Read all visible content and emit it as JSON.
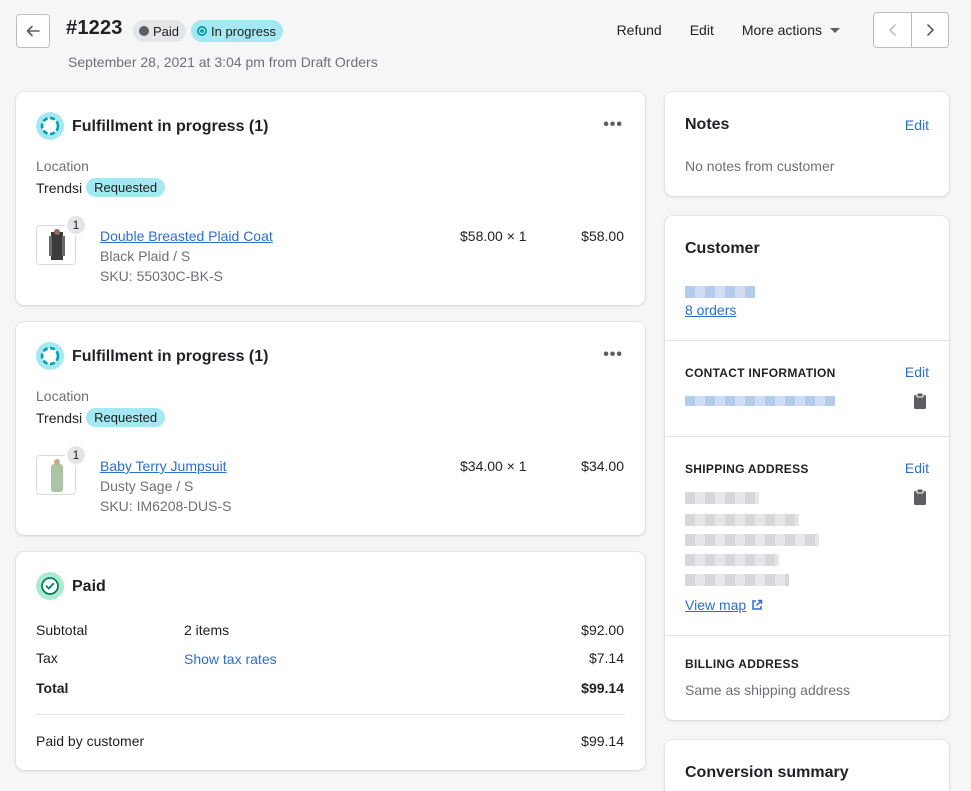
{
  "header": {
    "order_number": "#1223",
    "badges": {
      "paid": "Paid",
      "progress": "In progress"
    },
    "subtitle": "September 28, 2021 at 3:04 pm from Draft Orders",
    "actions": {
      "refund": "Refund",
      "edit": "Edit",
      "more": "More actions"
    }
  },
  "fulfillments": [
    {
      "title": "Fulfillment in progress (1)",
      "location_label": "Location",
      "location": "Trendsi",
      "status": "Requested",
      "item": {
        "qty_badge": "1",
        "name": "Double Breasted Plaid Coat",
        "variant": "Black Plaid / S",
        "sku": "SKU: 55030C-BK-S",
        "unit": "$58.00 × 1",
        "total": "$58.00"
      }
    },
    {
      "title": "Fulfillment in progress (1)",
      "location_label": "Location",
      "location": "Trendsi",
      "status": "Requested",
      "item": {
        "qty_badge": "1",
        "name": "Baby Terry Jumpsuit",
        "variant": "Dusty Sage / S",
        "sku": "SKU: IM6208-DUS-S",
        "unit": "$34.00 × 1",
        "total": "$34.00"
      }
    }
  ],
  "payment": {
    "title": "Paid",
    "subtotal_label": "Subtotal",
    "subtotal_items": "2 items",
    "subtotal_value": "$92.00",
    "tax_label": "Tax",
    "tax_link": "Show tax rates",
    "tax_value": "$7.14",
    "total_label": "Total",
    "total_value": "$99.14",
    "paid_label": "Paid by customer",
    "paid_value": "$99.14"
  },
  "notes": {
    "title": "Notes",
    "edit": "Edit",
    "text": "No notes from customer"
  },
  "customer": {
    "title": "Customer",
    "orders": "8 orders",
    "contact_title": "Contact information",
    "contact_edit": "Edit",
    "shipping_title": "Shipping address",
    "shipping_edit": "Edit",
    "view_map": "View map",
    "billing_title": "Billing address",
    "billing_text": "Same as shipping address"
  },
  "conversion": {
    "title": "Conversion summary"
  },
  "colors": {
    "accent": "#2c6ecb",
    "info_badge": "#a4e8f2",
    "success": "#aee9d1"
  }
}
